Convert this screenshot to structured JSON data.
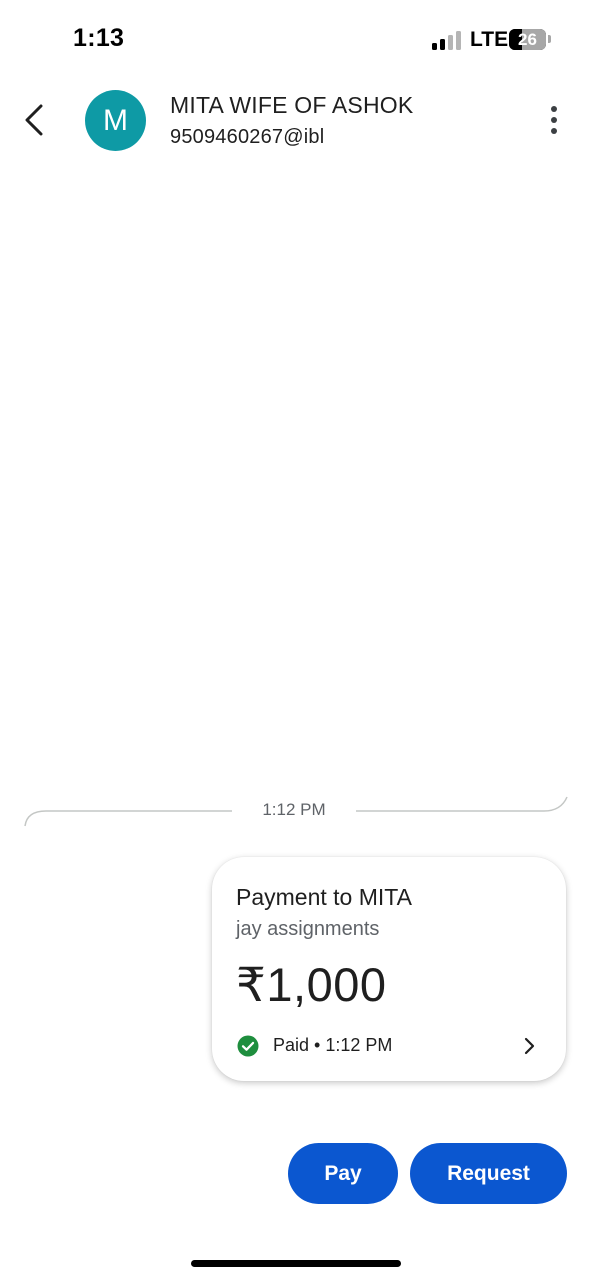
{
  "status_bar": {
    "time": "1:13",
    "network": "LTE",
    "battery_level": "26"
  },
  "header": {
    "avatar_initial": "M",
    "avatar_color": "#0e9aa5",
    "contact_name": "MITA WIFE OF ASHOK",
    "contact_upi": "9509460267@ibl",
    "back_icon": "chevron-left-icon",
    "more_icon": "more-vertical-icon"
  },
  "conversation": {
    "date_divider": "1:12 PM",
    "payment_card": {
      "title": "Payment to MITA",
      "note": "jay assignments",
      "amount": "₹1,000",
      "status": "Paid • 1:12 PM",
      "status_icon": "check-circle-icon",
      "status_color": "#1e8e3e"
    }
  },
  "actions": {
    "pay_label": "Pay",
    "request_label": "Request",
    "accent_color": "#0b57d0"
  }
}
